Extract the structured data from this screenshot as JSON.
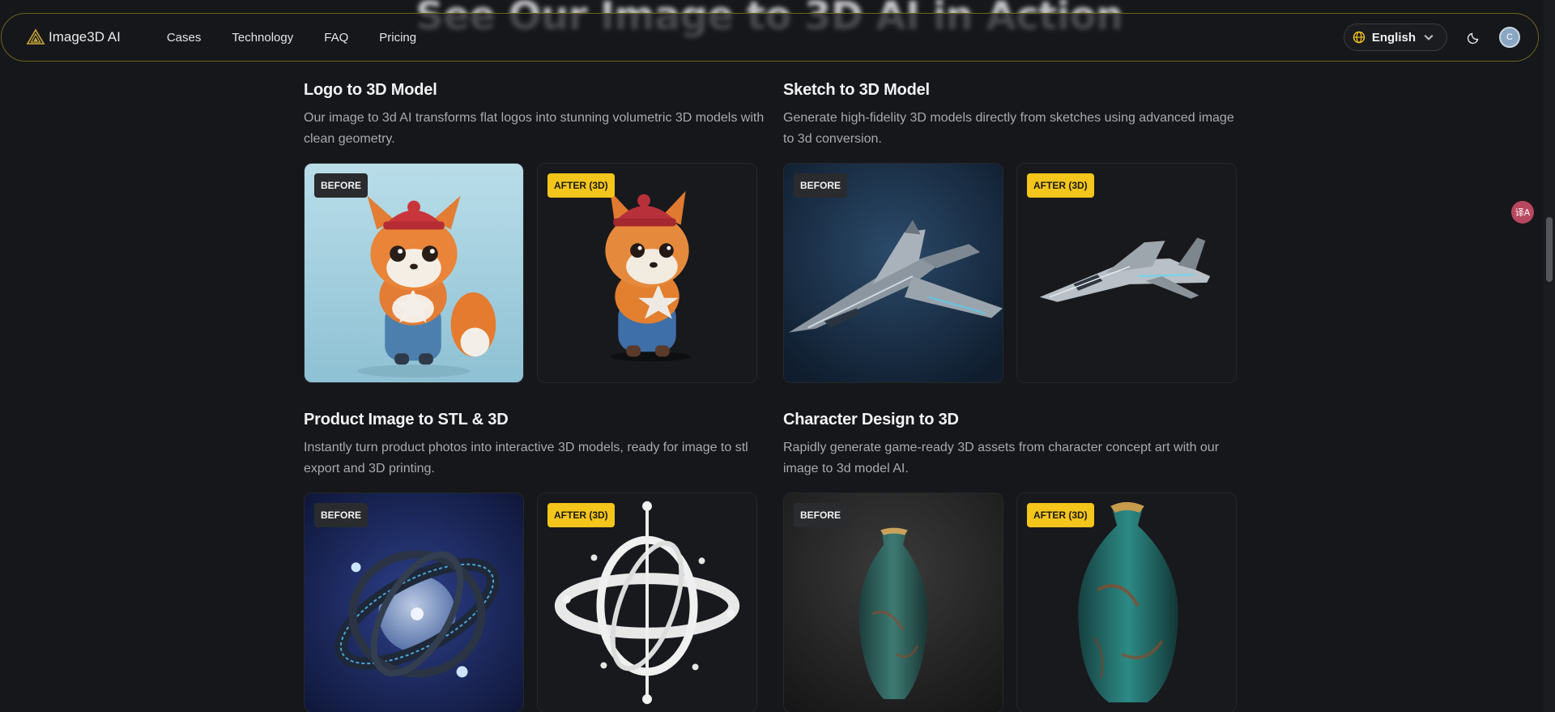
{
  "background_heading": "See Our Image to 3D AI in Action",
  "nav": {
    "brand": "Image3D AI",
    "links": [
      "Cases",
      "Technology",
      "FAQ",
      "Pricing"
    ],
    "language": "English",
    "avatar_initial": "C"
  },
  "colors": {
    "accent": "#f4c51a",
    "nav_border": "#6b6224",
    "background": "#16171a"
  },
  "badges": {
    "before": "BEFORE",
    "after": "AFTER (3D)"
  },
  "cases": [
    {
      "title": "Logo to 3D Model",
      "description": "Our image to 3d AI transforms flat logos into stunning volumetric 3D models with clean geometry.",
      "before_image": "fox-character-photo",
      "after_image": "fox-character-3d"
    },
    {
      "title": "Sketch to 3D Model",
      "description": "Generate high-fidelity 3D models directly from sketches using advanced image to 3d conversion.",
      "before_image": "fighter-jet-photo",
      "after_image": "fighter-jet-3d"
    },
    {
      "title": "Product Image to STL & 3D",
      "description": "Instantly turn product photos into interactive 3D models, ready for image to stl export and 3D printing.",
      "before_image": "armillary-sphere-photo",
      "after_image": "armillary-sphere-3d"
    },
    {
      "title": "Character Design to 3D",
      "description": "Rapidly generate game-ready 3D assets from character concept art with our image to 3d model AI.",
      "before_image": "vase-photo",
      "after_image": "vase-3d"
    }
  ],
  "translate_fab_label": "译A"
}
